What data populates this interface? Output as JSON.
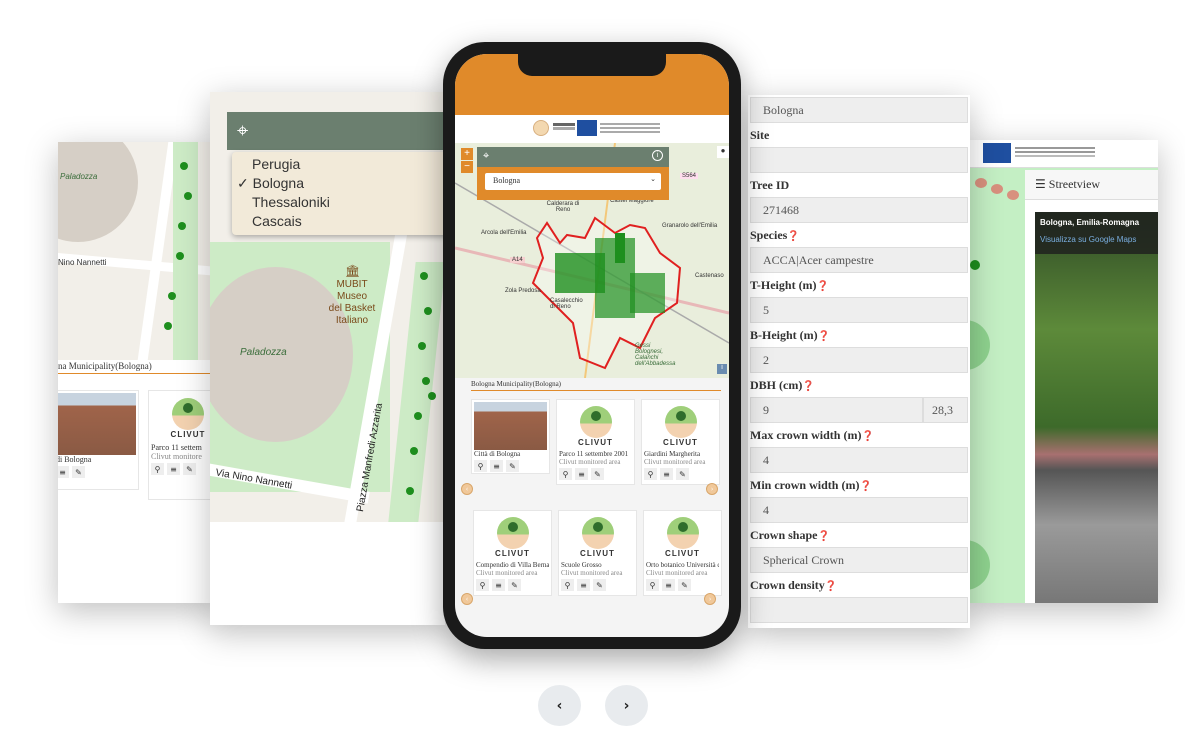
{
  "left_panel": {
    "map_labels": [
      "Paladozza",
      "Piazza Manfredi Azzarita",
      "Nino Nannetti"
    ],
    "municipality": "na Municipality(Bologna)",
    "cards": [
      {
        "title": "di Bologna"
      },
      {
        "title": "Parco 11 settem",
        "subtitle": "Clivut monitore"
      }
    ]
  },
  "city_panel": {
    "cities": [
      "Perugia",
      "Bologna",
      "Thessaloniki",
      "Cascais"
    ],
    "selected": "Bologna",
    "check": "✓",
    "map_labels": {
      "poi": "MUBIT\nMuseo\ndel Basket\nItaliano",
      "arena": "Paladozza",
      "street1": "Via Nino Nannetti",
      "street2": "Piazza Manfredi Azzarita"
    }
  },
  "phone": {
    "city_select": "Bologna",
    "zoom_in": "+",
    "zoom_out": "−",
    "map_labels": [
      "Calderara di Reno",
      "Castel Maggiore",
      "Granarolo dell'Emilia",
      "Arcola dell'Emilia",
      "A14",
      "Zola Predosa",
      "Casalecchio di Reno",
      "Castenaso",
      "S564",
      "Gessi Bolognesi, Calanchi dell'Abbadessa"
    ],
    "municipality": "Bologna Municipality(Bologna)",
    "logo_text": "CLIVUT",
    "cards": [
      {
        "title": "Città di Bologna",
        "subtitle": ""
      },
      {
        "title": "Parco 11 settembre 2001",
        "subtitle": "Clivut monitored area"
      },
      {
        "title": "Giardini Margherita",
        "subtitle": "Clivut monitored area"
      },
      {
        "title": "Compendio di Villa Bernar",
        "subtitle": "Clivut monitored area"
      },
      {
        "title": "Scuole Grosso",
        "subtitle": "Clivut monitored area"
      },
      {
        "title": "Orto botanico Università d",
        "subtitle": "Clivut monitored area"
      }
    ]
  },
  "form": {
    "city_value": "Bologna",
    "fields": [
      {
        "label": "Site",
        "value": ""
      },
      {
        "label": "Tree ID",
        "value": "271468"
      },
      {
        "label": "Species",
        "value": "ACCA|Acer campestre",
        "help": true
      },
      {
        "label": "T-Height (m)",
        "value": "5",
        "help": true
      },
      {
        "label": "B-Height (m)",
        "value": "2",
        "help": true
      },
      {
        "label": "DBH (cm)",
        "value": "9",
        "value2": "28,3",
        "help": true
      },
      {
        "label": "Max crown width (m)",
        "value": "4",
        "help": true
      },
      {
        "label": "Min crown width (m)",
        "value": "4",
        "help": true
      },
      {
        "label": "Crown shape",
        "value": "Spherical Crown",
        "help": true
      },
      {
        "label": "Crown density",
        "value": "",
        "help": true
      }
    ]
  },
  "streetview": {
    "title": "Streetview",
    "location": "Bologna, Emilia-Romagna",
    "link": "Visualizza su Google Maps"
  },
  "carousel": {
    "prev": "‹",
    "next": "›"
  },
  "colors": {
    "orange": "#e08a2a",
    "header_green": "#6b7f6f",
    "dropdown_bg": "#f2ead9",
    "tree_green": "#1e8f1e",
    "boundary": "#e02020"
  }
}
